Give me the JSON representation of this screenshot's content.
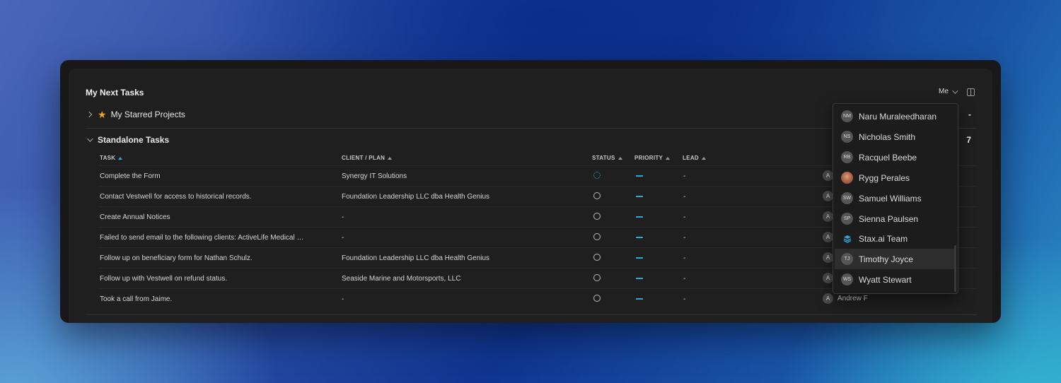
{
  "title": "My Next Tasks",
  "filter": {
    "value": "Me"
  },
  "sections": [
    {
      "label": "My Starred Projects",
      "count": "-"
    },
    {
      "label": "Standalone Tasks",
      "count": "7"
    }
  ],
  "columns": {
    "task": "TASK",
    "client": "CLIENT / PLAN",
    "status": "STATUS",
    "priority": "PRIORITY",
    "lead": "LEAD"
  },
  "rows": [
    {
      "task": "Complete the Form",
      "client": "Synergy IT Solutions",
      "lead": "-",
      "assignee_initial": "A",
      "assignee": "",
      "status": "in-progress"
    },
    {
      "task": "Contact Vestwell for access to historical records.",
      "client": "Foundation Leadership LLC dba Health Genius",
      "lead": "-",
      "assignee_initial": "A",
      "assignee": "",
      "status": "open"
    },
    {
      "task": "Create Annual Notices",
      "client": "-",
      "lead": "-",
      "assignee_initial": "A",
      "assignee": "",
      "status": "open"
    },
    {
      "task": "Failed to send email to the following clients: ActiveLife Medical …",
      "client": "-",
      "lead": "-",
      "assignee_initial": "A",
      "assignee": "",
      "status": "open"
    },
    {
      "task": "Follow up on beneficiary form for Nathan Schulz.",
      "client": "Foundation Leadership LLC dba Health Genius",
      "lead": "-",
      "assignee_initial": "A",
      "assignee": "",
      "status": "open"
    },
    {
      "task": "Follow up with Vestwell on refund status.",
      "client": "Seaside Marine and Motorsports, LLC",
      "lead": "-",
      "assignee_initial": "A",
      "assignee": "",
      "status": "open"
    },
    {
      "task": "Took a call from Jaime.",
      "client": "-",
      "lead": "-",
      "assignee_initial": "A",
      "assignee": "Andrew F",
      "status": "open"
    }
  ],
  "dropdown": {
    "items": [
      {
        "initials": "NM",
        "name": "Naru Muraleedharan"
      },
      {
        "initials": "NS",
        "name": "Nicholas Smith"
      },
      {
        "initials": "RB",
        "name": "Racquel Beebe"
      },
      {
        "initials": "",
        "name": "Rygg Perales",
        "avatar": "photo"
      },
      {
        "initials": "SW",
        "name": "Samuel Williams"
      },
      {
        "initials": "SP",
        "name": "Sienna Paulsen"
      },
      {
        "initials": "",
        "name": "Stax.ai Team",
        "avatar": "stax-logo"
      },
      {
        "initials": "TJ",
        "name": "Timothy Joyce",
        "highlighted": true
      },
      {
        "initials": "WS",
        "name": "Wyatt Stewart"
      }
    ]
  },
  "colors": {
    "accent": "#2aa9d6",
    "star": "#f2a521",
    "panel": "#1f1f1f"
  }
}
